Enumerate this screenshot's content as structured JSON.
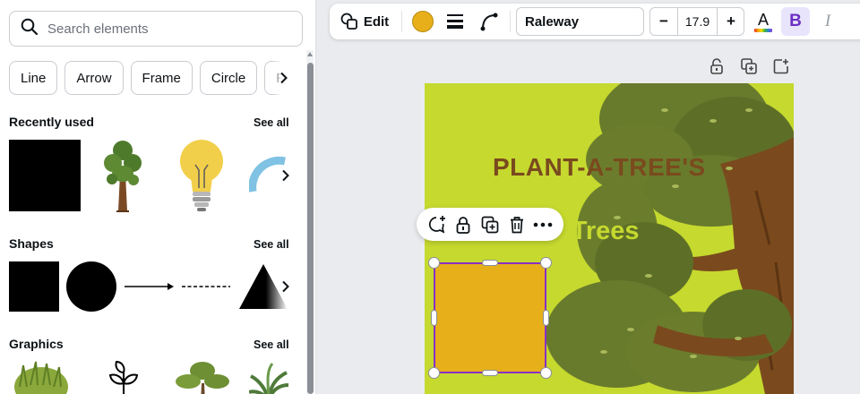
{
  "search": {
    "placeholder": "Search elements"
  },
  "chips": [
    "Line",
    "Arrow",
    "Frame",
    "Circle",
    "Re"
  ],
  "sections": {
    "recent": {
      "title": "Recently used",
      "see_all": "See all"
    },
    "shapes": {
      "title": "Shapes",
      "see_all": "See all"
    },
    "graphics": {
      "title": "Graphics",
      "see_all": "See all"
    }
  },
  "toolbar": {
    "edit_label": "Edit",
    "fill_color": "#e7b01b",
    "font": "Raleway",
    "minus": "−",
    "font_size": "17.9",
    "plus": "+",
    "text_color_letter": "A",
    "bold_letter": "B",
    "italic_letter": "I"
  },
  "canvas": {
    "title_line1": "PLANT-A-TREE'S",
    "title_line2": "n Trees",
    "page_color": "#c5d92f",
    "title_color": "#7a4a1e"
  },
  "selection": {
    "shape_color": "#e7b01b",
    "border_color": "#8a2fc4"
  },
  "icons": {
    "search": "search-icon",
    "edit": "shapes-edit-icon",
    "border_style": "border-weight-icon",
    "corner": "corner-rounding-icon",
    "lock": "lock-icon",
    "duplicate": "duplicate-icon",
    "add_page": "add-page-icon",
    "comment": "add-comment-icon",
    "delete": "trash-icon",
    "more": "more-icon"
  }
}
